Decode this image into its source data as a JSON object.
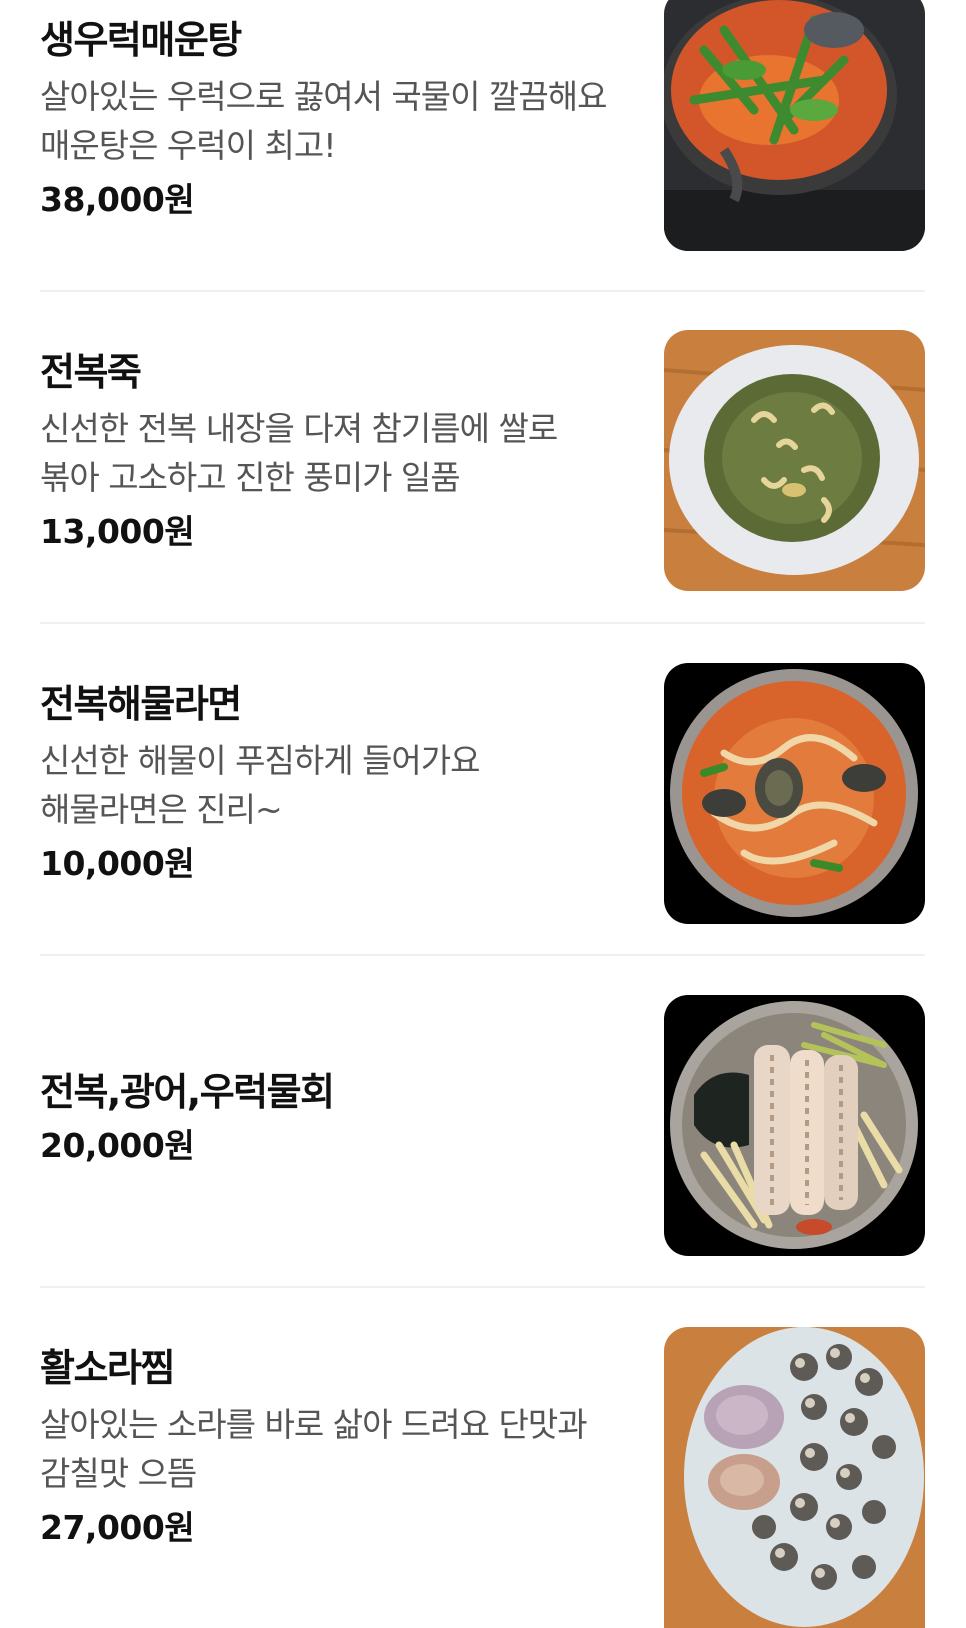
{
  "menu": {
    "items": [
      {
        "name": "생우럭매운탕",
        "description": "살아있는 우럭으로 끓여서 국물이 깔끔해요 매운탕은 우럭이 최고!",
        "price": "38,000원",
        "image": "spicy-rockfish-stew-photo"
      },
      {
        "name": "전복죽",
        "description": "신선한 전복 내장을 다져 참기름에 쌀로 볶아 고소하고 진한 풍미가 일품",
        "price": "13,000원",
        "image": "abalone-porridge-photo"
      },
      {
        "name": "전복해물라면",
        "description": "신선한 해물이 푸짐하게 들어가요 해물라면은 진리~",
        "price": "10,000원",
        "image": "abalone-seafood-ramen-photo"
      },
      {
        "name": "전복,광어,우럭물회",
        "description": "",
        "price": "20,000원",
        "image": "cold-raw-fish-soup-photo"
      },
      {
        "name": "활소라찜",
        "description": "살아있는 소라를 바로 삶아 드려요 단맛과 감칠맛 으뜸",
        "price": "27,000원",
        "image": "steamed-conch-photo"
      }
    ]
  }
}
